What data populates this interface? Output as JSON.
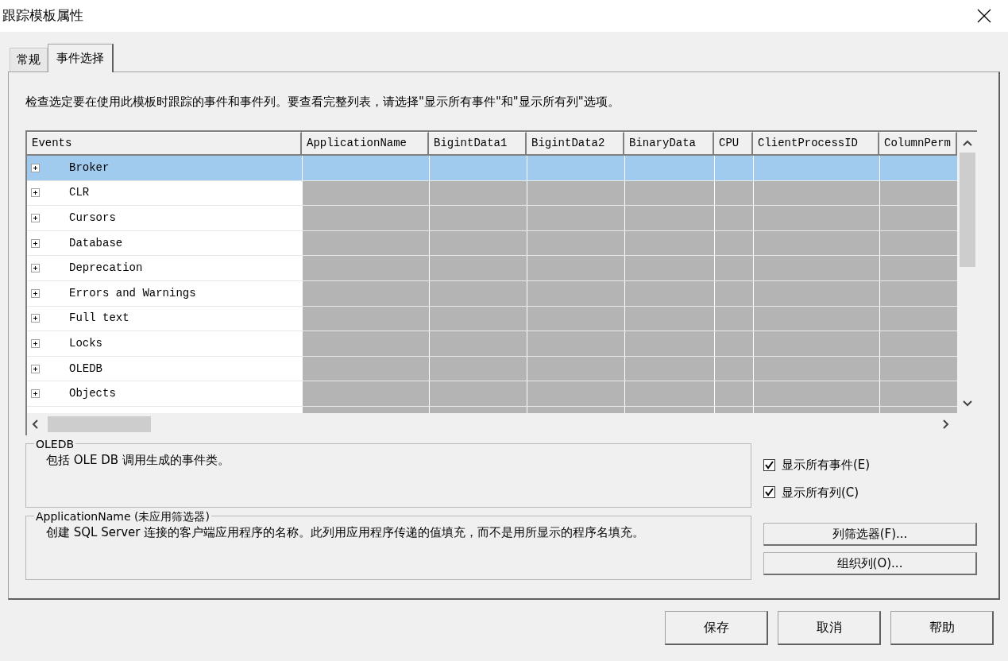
{
  "window": {
    "title": "跟踪模板属性"
  },
  "tabs": [
    {
      "label": "常规",
      "selected": false
    },
    {
      "label": "事件选择",
      "selected": true
    }
  ],
  "instructions": "检查选定要在使用此模板时跟踪的事件和事件列。要查看完整列表，请选择\"显示所有事件\"和\"显示所有列\"选项。",
  "grid": {
    "columns": [
      "Events",
      "ApplicationName",
      "BigintData1",
      "BigintData2",
      "BinaryData",
      "CPU",
      "ClientProcessID",
      "ColumnPerm"
    ],
    "rows": [
      {
        "event": "Broker",
        "selected": true,
        "expanded": false
      },
      {
        "event": "CLR",
        "selected": false,
        "expanded": false
      },
      {
        "event": "Cursors",
        "selected": false,
        "expanded": false
      },
      {
        "event": "Database",
        "selected": false,
        "expanded": false
      },
      {
        "event": "Deprecation",
        "selected": false,
        "expanded": false
      },
      {
        "event": "Errors and Warnings",
        "selected": false,
        "expanded": false
      },
      {
        "event": "Full text",
        "selected": false,
        "expanded": false
      },
      {
        "event": "Locks",
        "selected": false,
        "expanded": false
      },
      {
        "event": "OLEDB",
        "selected": false,
        "expanded": false
      },
      {
        "event": "Objects",
        "selected": false,
        "expanded": false
      }
    ]
  },
  "groups": [
    {
      "title": "OLEDB",
      "text": "包括 OLE DB 调用生成的事件类。"
    },
    {
      "title": "ApplicationName (未应用筛选器)",
      "text": "创建 SQL Server 连接的客户端应用程序的名称。此列用应用程序传递的值填充，而不是用所显示的程序名填充。"
    }
  ],
  "checkboxes": [
    {
      "label": "显示所有事件(E)",
      "checked": true
    },
    {
      "label": "显示所有列(C)",
      "checked": true
    }
  ],
  "side_buttons": [
    "列筛选器(F)...",
    "组织列(O)..."
  ],
  "footer_buttons": [
    "保存",
    "取消",
    "帮助"
  ]
}
